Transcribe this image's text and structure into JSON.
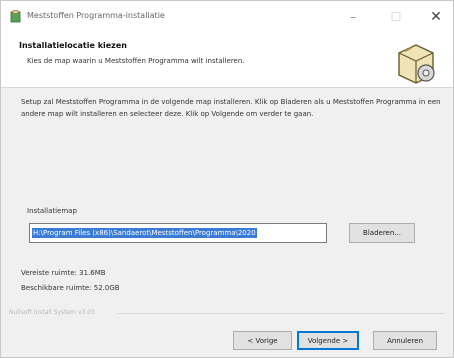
{
  "window": {
    "title": "Meststoffen Programma-installatie",
    "controls": {
      "minimize": "–",
      "maximize": "☐",
      "close": "✕"
    }
  },
  "header": {
    "title": "Installatielocatie kiezen",
    "subtitle": "Kies de map waarin u Meststoffen Programma wilt installeren."
  },
  "body": {
    "description": "Setup zal Meststoffen Programma in de volgende map installeren. Klik op Bladeren als u Meststoffen Programma in een andere map wilt installeren en selecteer deze. Klik op Volgende om verder te gaan.",
    "destination": {
      "label": "Installatiemap",
      "value": "H:\\Program Files (x86)\\Sandaerot\\Meststoffen\\Programma\\2020",
      "browse_label": "Bladeren..."
    },
    "space_required": "Vereiste ruimte: 31.6MB",
    "space_available": "Beschikbare ruimte: 52.0GB"
  },
  "footer": {
    "brand": "Nullsoft Install System v3.03",
    "back_label": "< Vorige",
    "next_label": "Volgende >",
    "cancel_label": "Annuleren"
  },
  "colors": {
    "selection": "#3a7bd5",
    "default_button_border": "#0078d7",
    "window_bg": "#f0f0f0"
  },
  "icons": {
    "app": "installer-box-icon",
    "header": "installer-box-icon"
  }
}
